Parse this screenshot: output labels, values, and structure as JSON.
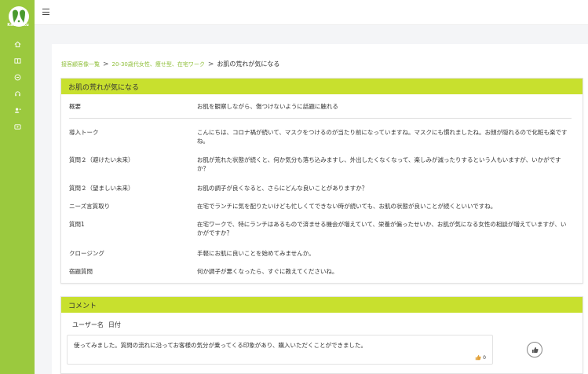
{
  "app": {
    "logo_text": "Kachikiku",
    "brand_color": "#9bc93e",
    "header_color": "#c8e02e"
  },
  "sidebar": {
    "items": [
      {
        "icon": "home-icon"
      },
      {
        "icon": "book-icon"
      },
      {
        "icon": "chat-icon"
      },
      {
        "icon": "headset-icon"
      },
      {
        "icon": "user-add-icon"
      },
      {
        "icon": "video-icon"
      }
    ]
  },
  "breadcrumb": {
    "items": [
      "接客顧客像一覧",
      "20-30歳代女性、痩せ型、在宅ワーク"
    ],
    "current": "お肌の荒れが気になる"
  },
  "topic_card": {
    "title": "お肌の荒れが気になる",
    "rows": [
      {
        "label": "概要",
        "value": "お肌を観察しながら、傷つけないように話題に触れる"
      },
      {
        "label": "導入トーク",
        "value": "こんにちは、コロナ禍が続いて、マスクをつけるのが当たり前になっていますね。マスクにも慣れましたね。お顔が隠れるので化粧も楽ですね。"
      },
      {
        "label": "質問２（避けたい未来）",
        "value": "お肌が荒れた状態が続くと、何か気分も落ち込みますし、外出したくなくなって、楽しみが減ったりするという人もいますが、いかがですか？"
      },
      {
        "label": "質問２（望ましい未来）",
        "value": "お肌の調子が良くなると、さらにどんな良いことがありますか？"
      },
      {
        "label": "ニーズ言質取り",
        "value": "在宅でランチに気を配りたいけども忙しくてできない時が続いても、お肌の状態が良いことが続くといいですね。"
      },
      {
        "label": "質問1",
        "value": "在宅ワークで、特にランチはあるもので済ませる機会が増えていて、栄養が偏ったせいか、お肌が気になる女性の相談が増えていますが、いかがですか？"
      },
      {
        "label": "クロージング",
        "value": "手軽にお肌に良いことを始めてみませんか。"
      },
      {
        "label": "宿題質問",
        "value": "何か調子が悪くなったら、すぐに教えてくださいね。"
      }
    ]
  },
  "comment_card": {
    "title": "コメント",
    "user_label": "ユーザー名",
    "date_label": "日付",
    "comment_text": "使ってみました。質問の流れに沿ってお客様の気分が乗ってくる印象があり、購入いただくことができました。",
    "like_count": "0"
  }
}
